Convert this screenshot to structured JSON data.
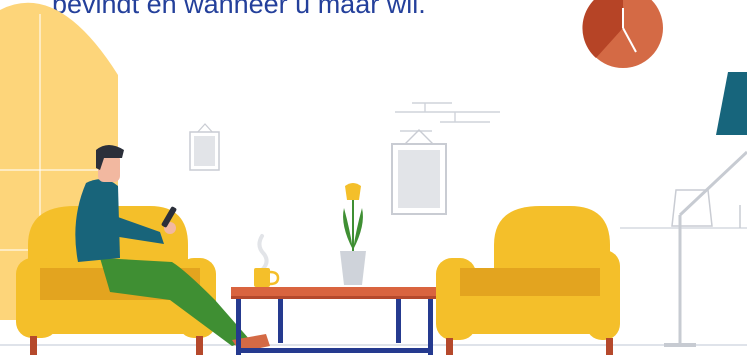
{
  "hero": {
    "heading_fragment": "bevindt en wanneer u maar wil."
  },
  "colors": {
    "heading": "#24409b",
    "window_yellow": "#fdd57a",
    "armchair_yellow": "#f4bf2a",
    "armchair_shade": "#e3a41f",
    "armchair_legs": "#b5492c",
    "clock_face": "#d46a45",
    "clock_shadow": "#b64426",
    "shirt_teal": "#18647a",
    "trousers_green": "#3f8f33",
    "table_top": "#d9643f",
    "table_frame": "#253a8f",
    "lamp_shade": "#17657c",
    "floor_line": "#dfe3ea"
  },
  "scene": {
    "icons": [
      "arched-window",
      "wall-clock",
      "picture-frame",
      "armchair",
      "person-with-phone",
      "coffee-mug",
      "tulip-vase",
      "coffee-table",
      "floor-lamp"
    ]
  }
}
